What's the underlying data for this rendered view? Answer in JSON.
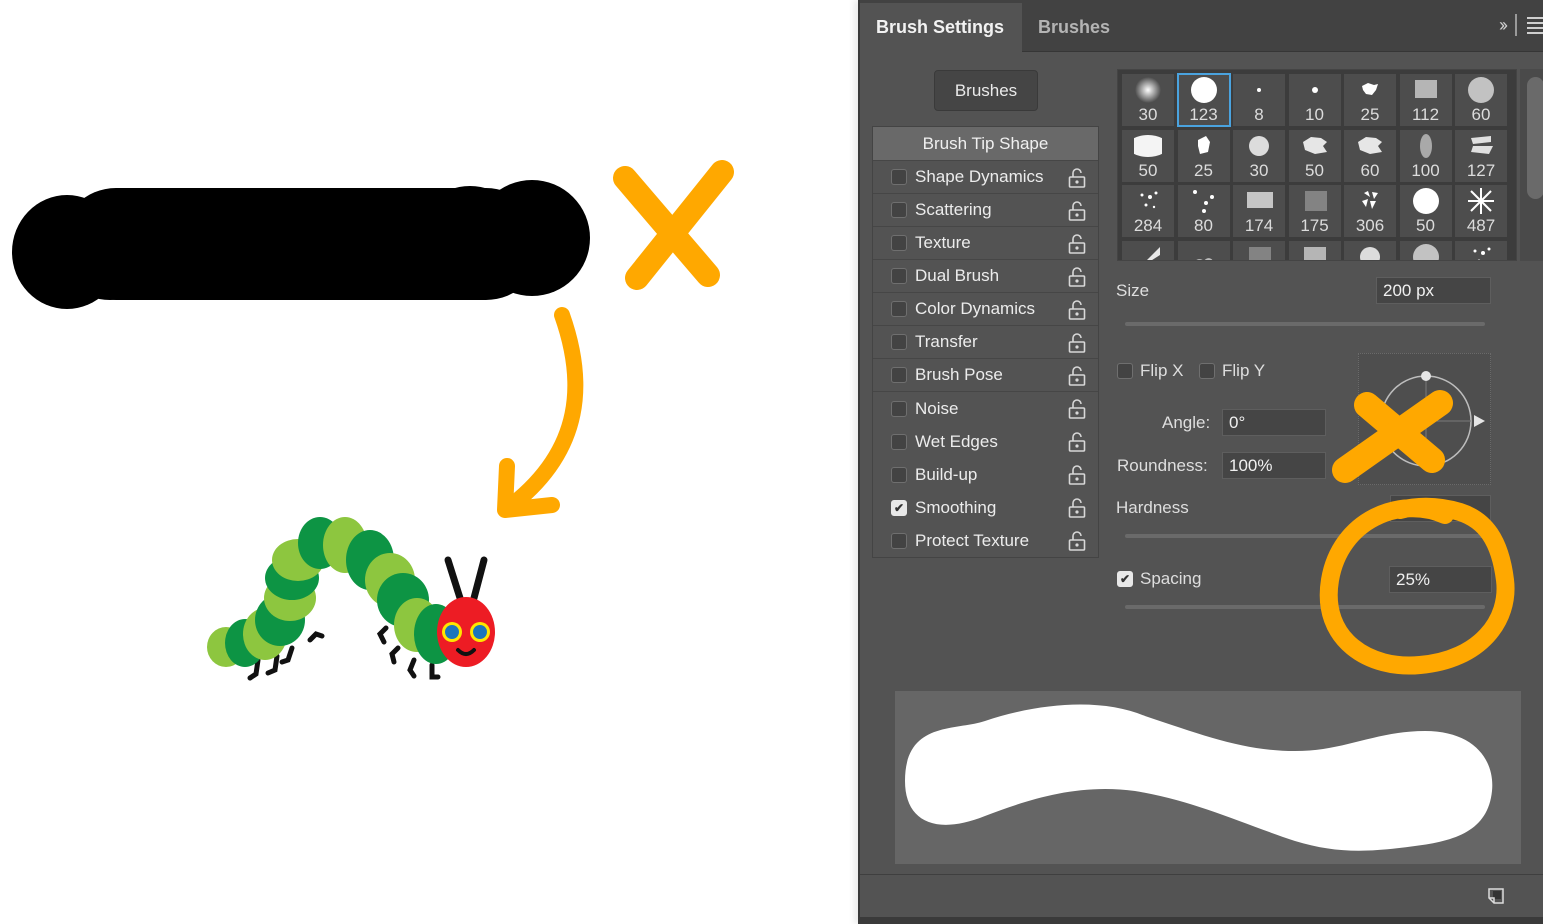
{
  "panel": {
    "tabs": [
      {
        "label": "Brush Settings",
        "active": true
      },
      {
        "label": "Brushes",
        "active": false
      }
    ],
    "collapse_icon": "double-chevron-right-icon",
    "menu_icon": "hamburger-menu-icon",
    "brushes_button": "Brushes",
    "brush_tip_shape": "Brush Tip Shape",
    "options": [
      {
        "label": "Shape Dynamics",
        "checked": false,
        "lock": "unlocked"
      },
      {
        "label": "Scattering",
        "checked": false,
        "lock": "unlocked"
      },
      {
        "label": "Texture",
        "checked": false,
        "lock": "unlocked"
      },
      {
        "label": "Dual Brush",
        "checked": false,
        "lock": "unlocked"
      },
      {
        "label": "Color Dynamics",
        "checked": false,
        "lock": "unlocked"
      },
      {
        "label": "Transfer",
        "checked": false,
        "lock": "unlocked"
      },
      {
        "label": "Brush Pose",
        "checked": false,
        "lock": "unlocked"
      },
      {
        "label": "Noise",
        "checked": false,
        "lock": "unlocked"
      },
      {
        "label": "Wet Edges",
        "checked": false,
        "lock": "unlocked"
      },
      {
        "label": "Build-up",
        "checked": false,
        "lock": "unlocked"
      },
      {
        "label": "Smoothing",
        "checked": true,
        "lock": "unlocked"
      },
      {
        "label": "Protect Texture",
        "checked": false,
        "lock": "unlocked"
      }
    ],
    "presets": [
      {
        "size": "30",
        "kind": "soft-round"
      },
      {
        "size": "123",
        "kind": "hard-round",
        "selected": true
      },
      {
        "size": "8",
        "kind": "tiny-dot"
      },
      {
        "size": "10",
        "kind": "small-dot"
      },
      {
        "size": "25",
        "kind": "splatter"
      },
      {
        "size": "112",
        "kind": "texture-rect"
      },
      {
        "size": "60",
        "kind": "speckle-round"
      },
      {
        "size": "50",
        "kind": "soft-oval"
      },
      {
        "size": "25",
        "kind": "blob"
      },
      {
        "size": "30",
        "kind": "fuzzy"
      },
      {
        "size": "50",
        "kind": "chalk"
      },
      {
        "size": "60",
        "kind": "chalk"
      },
      {
        "size": "100",
        "kind": "oval-gray"
      },
      {
        "size": "127",
        "kind": "dry-brush"
      },
      {
        "size": "284",
        "kind": "spatter-dots"
      },
      {
        "size": "80",
        "kind": "scattered-dots"
      },
      {
        "size": "174",
        "kind": "rough-stroke"
      },
      {
        "size": "175",
        "kind": "grain"
      },
      {
        "size": "306",
        "kind": "leaves"
      },
      {
        "size": "50",
        "kind": "hard-round"
      },
      {
        "size": "487",
        "kind": "star-burst"
      },
      {
        "size": "",
        "kind": "fan"
      },
      {
        "size": "",
        "kind": "cloud"
      },
      {
        "size": "",
        "kind": "grain"
      },
      {
        "size": "",
        "kind": "texture-rect"
      },
      {
        "size": "",
        "kind": "fuzzy"
      },
      {
        "size": "",
        "kind": "speckle-round"
      },
      {
        "size": "",
        "kind": "spatter-dots"
      }
    ],
    "size": {
      "label": "Size",
      "value": "200 px",
      "slider_fraction": 0.72
    },
    "flip_x": {
      "label": "Flip X",
      "checked": false
    },
    "flip_y": {
      "label": "Flip Y",
      "checked": false
    },
    "angle": {
      "label": "Angle:",
      "value": "0°"
    },
    "roundness": {
      "label": "Roundness:",
      "value": "100%"
    },
    "hardness": {
      "label": "Hardness",
      "value": "100%",
      "slider_fraction": 1.0
    },
    "spacing": {
      "label": "Spacing",
      "checked": true,
      "value": "25%",
      "slider_fraction": 0.1
    },
    "footer_icon": "create-new-brush-icon"
  },
  "annotations": {
    "color": "#FFA800",
    "items": [
      "x-mark-stroke",
      "arrow-to-caterpillar",
      "x-mark-angle",
      "circle-spacing"
    ]
  },
  "canvas": {
    "stroke_color": "#000000",
    "caterpillar": {
      "light_green": "#8DC63F",
      "dark_green": "#0D9444",
      "head": "#ED1C24",
      "eye_ring": "#FFE600",
      "eye": "#1C75BC"
    }
  }
}
